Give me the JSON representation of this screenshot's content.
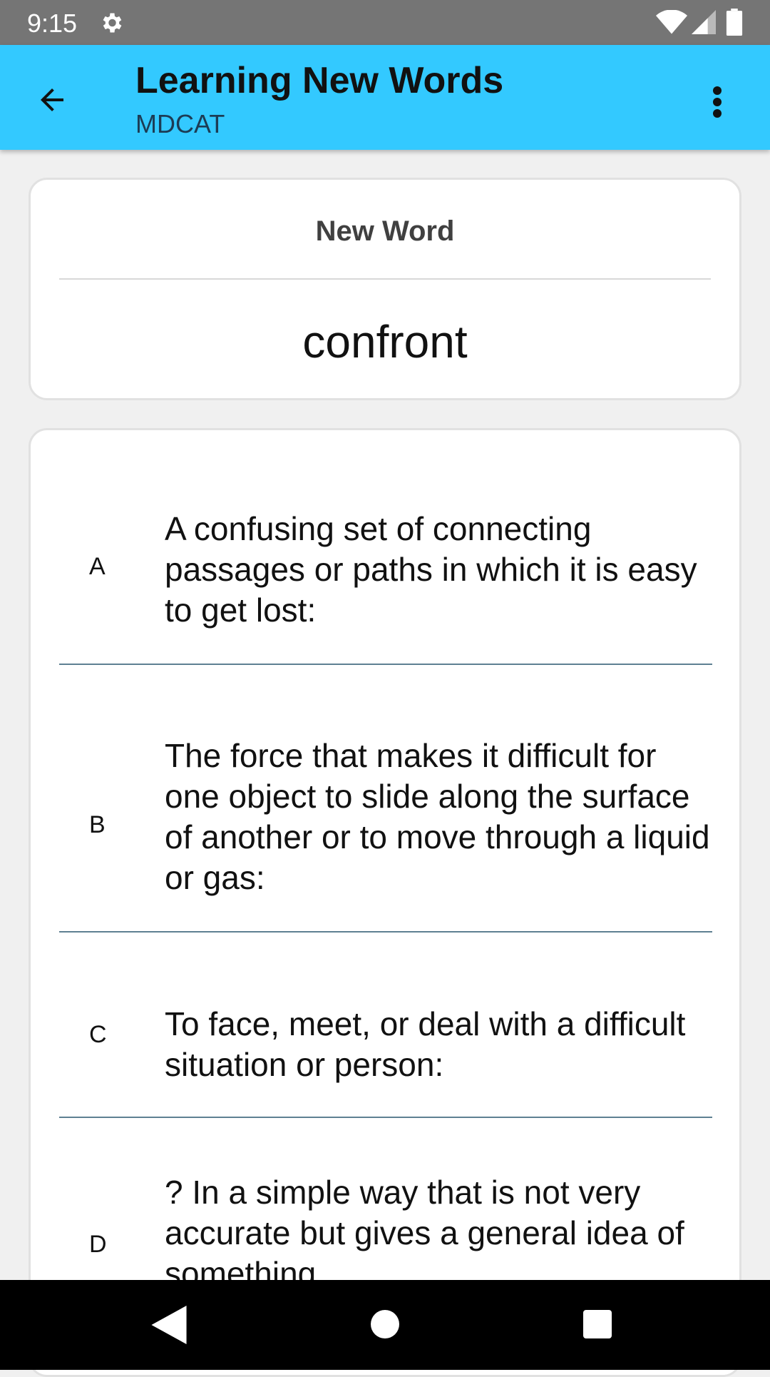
{
  "status_bar": {
    "time": "9:15",
    "icons": [
      "gear-icon",
      "wifi-icon",
      "signal-icon",
      "battery-icon"
    ]
  },
  "app_bar": {
    "title": "Learning New Words",
    "subtitle": "MDCAT",
    "back_icon": "arrow-back-icon",
    "menu_icon": "more-vert-icon",
    "background_color": "#33c9ff"
  },
  "word_card": {
    "title": "New Word",
    "word": "confront"
  },
  "options": [
    {
      "letter": "A",
      "text": "A confusing set of connecting passages or paths in which it is easy to get lost:"
    },
    {
      "letter": "B",
      "text": "The force that makes it difficult for one object to slide along the surface of another or to move through a liquid or gas:"
    },
    {
      "letter": "C",
      "text": "To face, meet, or deal with a difficult situation or person:"
    },
    {
      "letter": "D",
      "text": "? In a simple way that is not very accurate but gives a general idea of something"
    }
  ],
  "nav_bar": {
    "icons": [
      "nav-back-icon",
      "nav-home-icon",
      "nav-recents-icon"
    ]
  }
}
